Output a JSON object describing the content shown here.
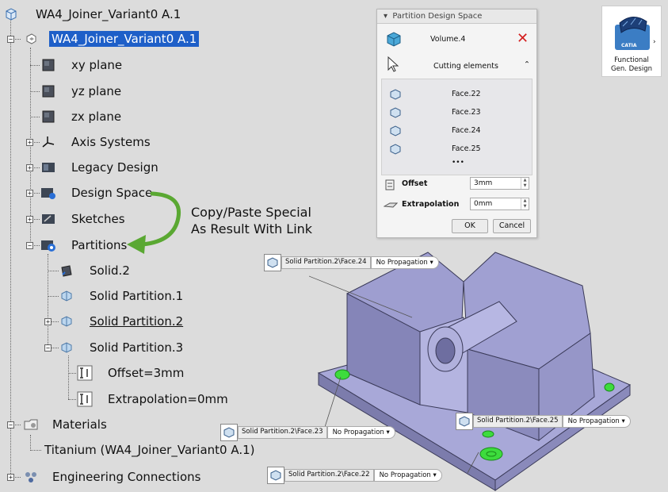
{
  "tree": {
    "root": "WA4_Joiner_Variant0 A.1",
    "part": "WA4_Joiner_Variant0 A.1",
    "planes": [
      "xy plane",
      "yz plane",
      "zx plane"
    ],
    "axis_systems": "Axis Systems",
    "legacy_design": "Legacy Design",
    "design_space": "Design Space",
    "sketches": "Sketches",
    "partitions": "Partitions",
    "solid": "Solid.2",
    "sp1": "Solid Partition.1",
    "sp2": "Solid Partition.2",
    "sp3": "Solid Partition.3",
    "offset": "Offset=3mm",
    "extrapolation": "Extrapolation=0mm",
    "materials": "Materials",
    "titanium": "Titanium (WA4_Joiner_Variant0 A.1)",
    "engineering": "Engineering Connections"
  },
  "annotation": {
    "line1": "Copy/Paste Special",
    "line2": "As Result With Link",
    "arrow_color": "#5aa832"
  },
  "panel": {
    "title": "Partition Design Space",
    "volume": "Volume.4",
    "cutting": "Cutting elements",
    "faces": [
      "Face.22",
      "Face.23",
      "Face.24",
      "Face.25"
    ],
    "more": "•••",
    "offset_label": "Offset",
    "offset_value": "3mm",
    "extrap_label": "Extrapolation",
    "extrap_value": "0mm",
    "ok": "OK",
    "cancel": "Cancel"
  },
  "badge": {
    "logo": "CATIA",
    "line1": "Functional",
    "line2": "Gen. Design"
  },
  "tags": [
    {
      "name": "Solid Partition.2\\Face.24",
      "prop": "No Propagation"
    },
    {
      "name": "Solid Partition.2\\Face.23",
      "prop": "No Propagation"
    },
    {
      "name": "Solid Partition.2\\Face.25",
      "prop": "No Propagation"
    },
    {
      "name": "Solid Partition.2\\Face.22",
      "prop": "No Propagation"
    }
  ],
  "colors": {
    "selection": "#1e5fc8",
    "part": "#9b9bcc",
    "highlight": "#3ddc3d",
    "delete": "#d42020"
  }
}
